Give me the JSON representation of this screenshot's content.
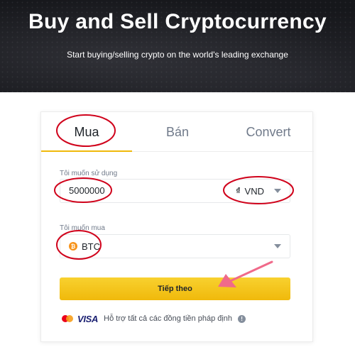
{
  "hero": {
    "title": "Buy and Sell Cryptocurrency",
    "subtitle": "Start buying/selling crypto on the world's leading exchange"
  },
  "tabs": [
    {
      "label": "Mua",
      "active": true
    },
    {
      "label": "Bán",
      "active": false
    },
    {
      "label": "Convert",
      "active": false
    }
  ],
  "spend": {
    "label": "Tôi muốn sử dụng",
    "value": "5000000",
    "currency_symbol": "₫",
    "currency": "VND"
  },
  "buy": {
    "label": "Tôi muốn mua",
    "coin_symbol": "₿",
    "coin": "BTC"
  },
  "next_button": "Tiếp theo",
  "payments": {
    "visa": "VISA",
    "text": "Hỗ trợ tất cả các đồng tiền pháp định",
    "info": "!"
  },
  "colors": {
    "accent": "#f0b90b",
    "hero_bg": "#16171b",
    "annotation": "#d0021b",
    "arrow": "#f06a8a"
  },
  "icons": [
    "caret-down-icon",
    "btc-icon",
    "mastercard-icon",
    "visa-icon",
    "info-icon"
  ]
}
